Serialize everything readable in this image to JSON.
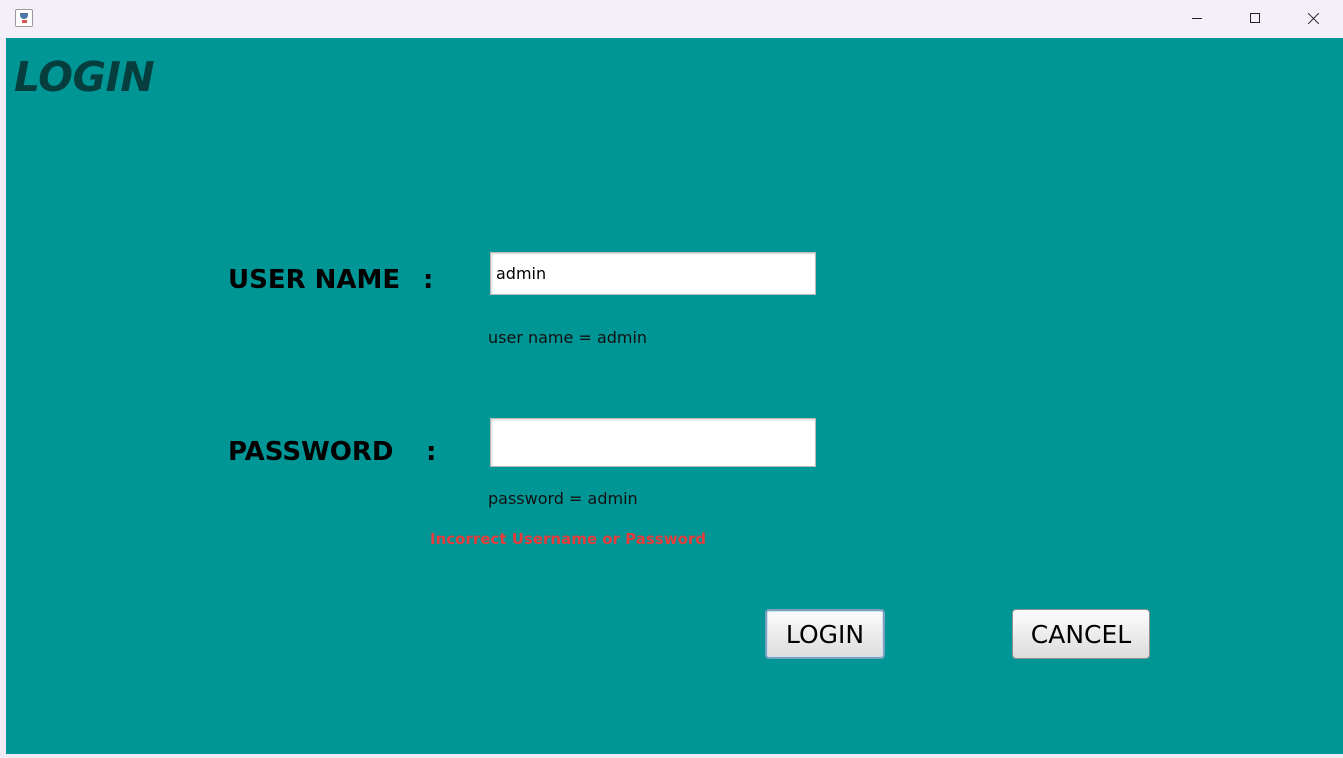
{
  "window": {
    "icon": "java-cup-icon",
    "controls": {
      "minimize": "minimize-icon",
      "maximize": "maximize-icon",
      "close": "close-icon"
    }
  },
  "page": {
    "title": "LOGIN",
    "background_color": "#009696",
    "title_color": "#063d3d"
  },
  "form": {
    "username": {
      "label": "USER NAME",
      "colon": ":",
      "value": "admin",
      "hint": "user name = admin"
    },
    "password": {
      "label": "PASSWORD",
      "colon": ":",
      "value": "",
      "hint": "password = admin"
    },
    "error": {
      "text": "Incorrect Username or Password",
      "color": "#e63c3c"
    }
  },
  "buttons": {
    "login": "LOGIN",
    "cancel": "CANCEL"
  }
}
